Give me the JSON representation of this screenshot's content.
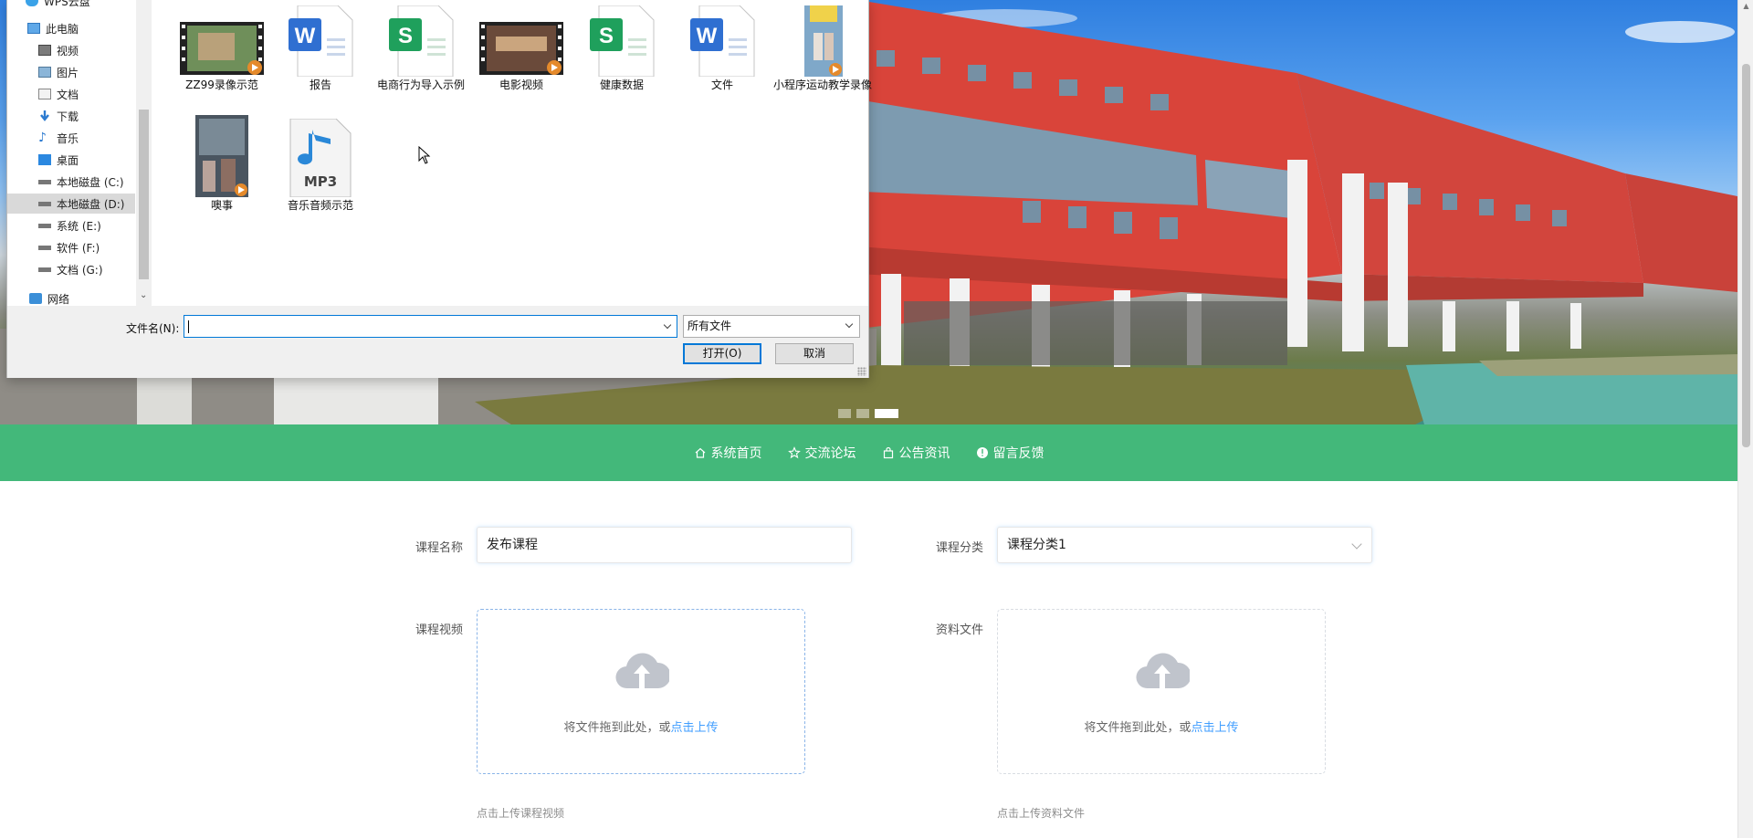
{
  "file_dialog": {
    "tree_items": [
      {
        "label": "WPS云盘",
        "icon": "cloud-drive-icon"
      },
      {
        "label": "此电脑",
        "icon": "computer-icon"
      },
      {
        "label": "视频",
        "icon": "video-folder-icon"
      },
      {
        "label": "图片",
        "icon": "pictures-folder-icon"
      },
      {
        "label": "文档",
        "icon": "documents-folder-icon"
      },
      {
        "label": "下载",
        "icon": "download-icon"
      },
      {
        "label": "音乐",
        "icon": "music-icon"
      },
      {
        "label": "桌面",
        "icon": "desktop-icon"
      },
      {
        "label": "本地磁盘 (C:)",
        "icon": "drive-icon"
      },
      {
        "label": "本地磁盘 (D:)",
        "icon": "drive-icon"
      },
      {
        "label": "系统 (E:)",
        "icon": "drive-icon"
      },
      {
        "label": "软件 (F:)",
        "icon": "drive-icon"
      },
      {
        "label": "文档 (G:)",
        "icon": "drive-icon"
      },
      {
        "label": "网络",
        "icon": "network-icon"
      }
    ],
    "files": [
      {
        "name": "ZZ99录像示范",
        "kind": "video"
      },
      {
        "name": "报告",
        "kind": "word"
      },
      {
        "name": "电商行为导入示例",
        "kind": "sheet"
      },
      {
        "name": "电影视频",
        "kind": "video"
      },
      {
        "name": "健康数据",
        "kind": "sheet"
      },
      {
        "name": "文件",
        "kind": "word"
      },
      {
        "name": "小程序运动教学录像",
        "kind": "video"
      },
      {
        "name": "噢事",
        "kind": "video"
      },
      {
        "name": "音乐音频示范",
        "kind": "mp3"
      }
    ],
    "filename_label": "文件名(N):",
    "filename_value": "",
    "file_type": "所有文件",
    "open_button": "打开(O)",
    "cancel_button": "取消",
    "word_letter": "W",
    "sheet_letter": "S",
    "mp3_label": "MP3"
  },
  "nav": {
    "items": [
      {
        "label": "系统首页",
        "icon": "home-icon"
      },
      {
        "label": "交流论坛",
        "icon": "star-icon"
      },
      {
        "label": "公告资讯",
        "icon": "bag-icon"
      },
      {
        "label": "留言反馈",
        "icon": "info-icon"
      }
    ]
  },
  "form": {
    "course_name_label": "课程名称",
    "course_name_value": "发布课程",
    "course_category_label": "课程分类",
    "course_category_value": "课程分类1",
    "course_video_label": "课程视频",
    "material_file_label": "资料文件",
    "upload_text": "将文件拖到此处，或",
    "upload_link": "点击上传",
    "video_tip": "点击上传课程视频",
    "file_tip": "点击上传资料文件"
  },
  "colors": {
    "nav_green": "#43b87a",
    "link_blue": "#409eff",
    "dialog_accent": "#0078d7"
  },
  "carousel": {
    "count": 3,
    "active": 2
  }
}
